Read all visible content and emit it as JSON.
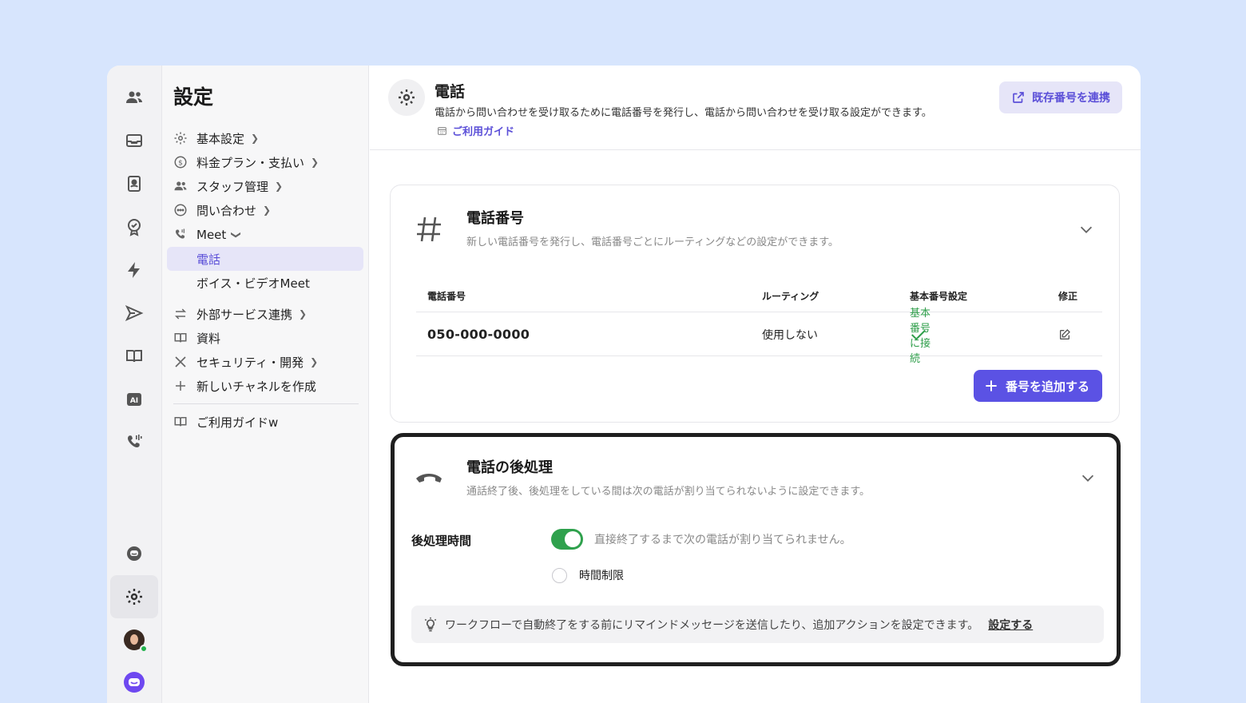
{
  "nav": {
    "title": "設定",
    "items": [
      {
        "label": "基本設定",
        "icon": "gear-icon"
      },
      {
        "label": "料金プラン・支払い",
        "icon": "dollar-icon"
      },
      {
        "label": "スタッフ管理",
        "icon": "users-icon"
      },
      {
        "label": "問い合わせ",
        "icon": "chat-icon"
      },
      {
        "label": "Meet",
        "icon": "phone-icon"
      }
    ],
    "sub_items": [
      {
        "label": "電話"
      },
      {
        "label": "ボイス・ビデオMeet"
      }
    ],
    "items_after": [
      {
        "label": "外部サービス連携",
        "icon": "sync-icon"
      },
      {
        "label": "資料",
        "icon": "book-icon"
      },
      {
        "label": "セキュリティ・開発",
        "icon": "tools-icon"
      },
      {
        "label": "新しいチャネルを作成",
        "icon": "plus-icon"
      }
    ],
    "guide": {
      "label": "ご利用ガイドw",
      "icon": "book-icon"
    }
  },
  "header": {
    "title": "電話",
    "description": "電話から問い合わせを受け取るために電話番号を発行し、電話から問い合わせを受け取る設定ができます。",
    "guide_link": "ご利用ガイド",
    "connect_button": "既存番号を連携"
  },
  "phone_card": {
    "title": "電話番号",
    "description": "新しい電話番号を発行し、電話番号ごとにルーティングなどの設定ができます。",
    "columns": [
      "電話番号",
      "ルーティング",
      "基本番号設定",
      "修正"
    ],
    "rows": [
      {
        "number": "050-000-0000",
        "routing": "使用しない",
        "default_status": "基本番号に接続"
      }
    ],
    "add_button": "番号を追加する"
  },
  "post_card": {
    "title": "電話の後処理",
    "description": "通話終了後、後処理をしている間は次の電話が割り当てられないように設定できます。",
    "label": "後処理時間",
    "toggle_on": true,
    "toggle_text": "直接終了するまで次の電話が割り当てられません。",
    "checkbox_label": "時間制限",
    "checkbox_checked": false,
    "tip_text": "ワークフローで自動終了をする前にリマインドメッセージを送信したり、追加アクションを設定できます。",
    "tip_link": "設定する"
  },
  "colors": {
    "accent": "#5b52e4",
    "success": "#2fa14d",
    "background": "#d7e5fd"
  }
}
